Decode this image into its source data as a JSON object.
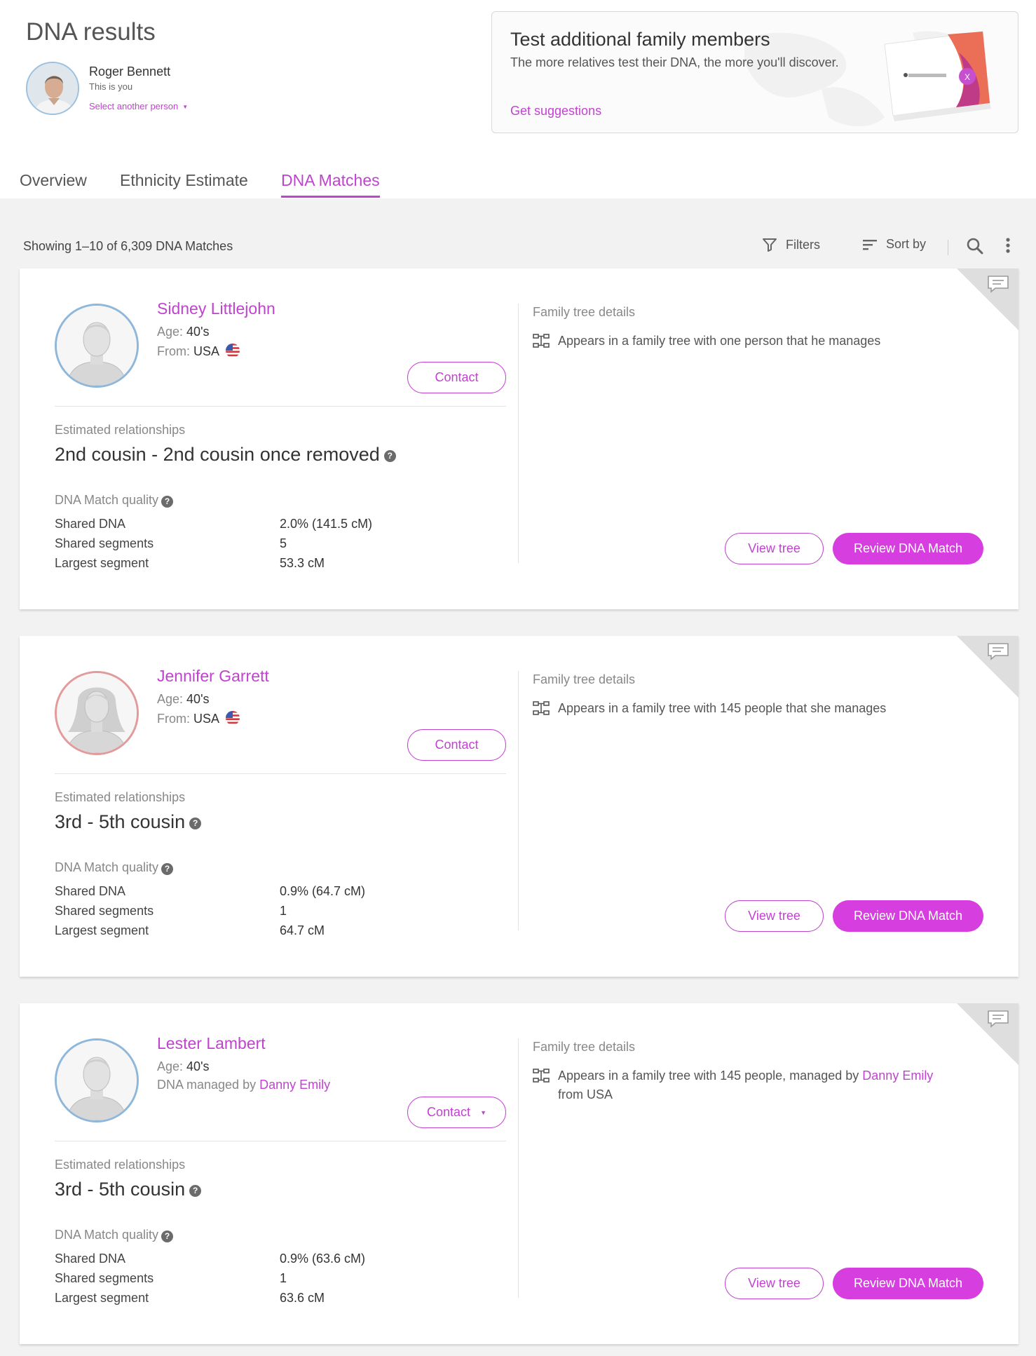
{
  "header": {
    "title": "DNA results",
    "person_name": "Roger Bennett",
    "person_sub": "This is you",
    "select_label": "Select another person"
  },
  "promo": {
    "title": "Test additional family members",
    "description": "The more relatives test their DNA, the more you'll discover.",
    "link": "Get suggestions"
  },
  "tabs": [
    {
      "label": "Overview",
      "active": false
    },
    {
      "label": "Ethnicity Estimate",
      "active": false
    },
    {
      "label": "DNA Matches",
      "active": true
    }
  ],
  "toolbar": {
    "showing": "Showing 1–10 of 6,309 DNA Matches",
    "filters": "Filters",
    "sort": "Sort by"
  },
  "labels": {
    "age": "Age:",
    "from": "From:",
    "managed_by": "DNA managed by",
    "contact": "Contact",
    "estimated": "Estimated relationships",
    "quality": "DNA Match quality",
    "shared_dna": "Shared DNA",
    "shared_segments": "Shared segments",
    "largest_segment": "Largest segment",
    "family_tree": "Family tree details",
    "view_tree": "View tree",
    "review": "Review DNA Match"
  },
  "matches": [
    {
      "name": "Sidney  Littlejohn",
      "age": "40's",
      "from": "USA",
      "relationship": "2nd cousin - 2nd cousin once removed",
      "shared_dna": "2.0% (141.5 cM)",
      "shared_segments": "5",
      "largest_segment": "53.3 cM",
      "tree_text": "Appears in a family tree with one person that he manages"
    },
    {
      "name": "Jennifer  Garrett",
      "age": "40's",
      "from": "USA",
      "relationship": "3rd - 5th cousin",
      "shared_dna": "0.9% (64.7 cM)",
      "shared_segments": "1",
      "largest_segment": "64.7 cM",
      "tree_text": "Appears in a family tree with 145 people that she manages"
    },
    {
      "name": "Lester Lambert",
      "age": "40's",
      "managed_by": "Danny Emily",
      "relationship": "3rd - 5th cousin",
      "shared_dna": "0.9% (63.6 cM)",
      "shared_segments": "1",
      "largest_segment": "63.6 cM",
      "tree_text_pre": "Appears in a family tree with 145 people, managed by",
      "tree_manager": "Danny Emily",
      "tree_text_post": "from USA"
    }
  ],
  "colors": {
    "accent": "#c043cf",
    "review_button": "#d63edf"
  }
}
